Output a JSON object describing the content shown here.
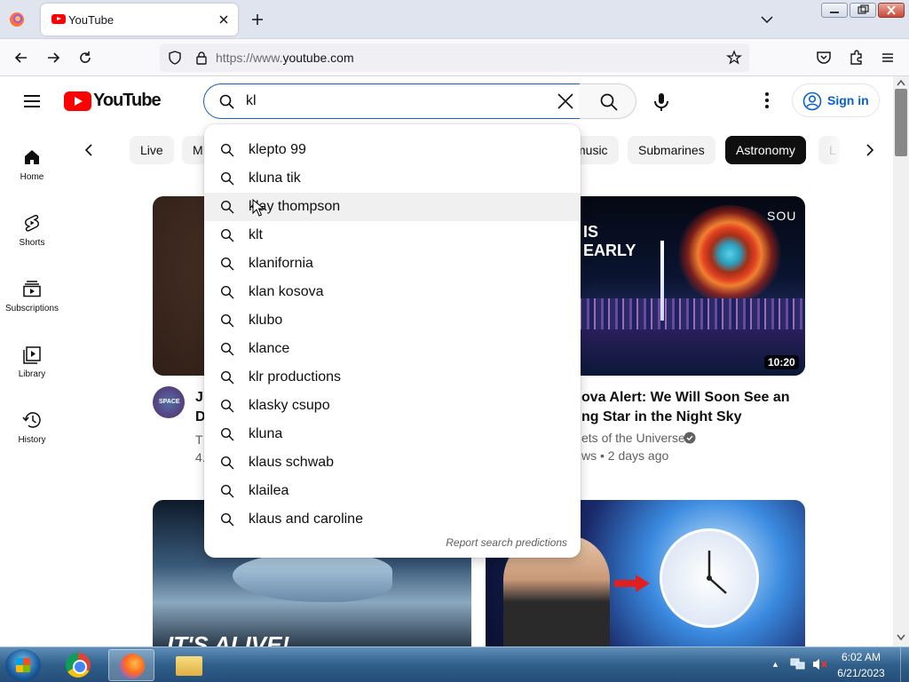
{
  "browser": {
    "tab_title": "YouTube",
    "url_prefix": "https://www.",
    "url_domain": "youtube.com"
  },
  "yt": {
    "logo_text": "YouTube",
    "search_value": "kl",
    "signin_label": "Sign in",
    "sidebar": [
      {
        "label": "Home",
        "icon": "home-icon"
      },
      {
        "label": "Shorts",
        "icon": "shorts-icon"
      },
      {
        "label": "Subscriptions",
        "icon": "subscriptions-icon"
      },
      {
        "label": "Library",
        "icon": "library-icon"
      },
      {
        "label": "History",
        "icon": "history-icon"
      }
    ],
    "chips": [
      "Live",
      "M",
      "music",
      "Submarines",
      "Astronomy",
      "L"
    ],
    "active_chip": "Astronomy",
    "suggestions": [
      "klepto 99",
      "kluna tik",
      "klay thompson",
      "klt",
      "klanifornia",
      "klan kosova",
      "klubo",
      "klance",
      "klr productions",
      "klasky csupo",
      "kluna",
      "klaus schwab",
      "klailea",
      "klaus and caroline"
    ],
    "report_link": "Report search predictions",
    "video_1": {
      "title_lines": [
        "J",
        "D"
      ],
      "meta_lines": [
        "T",
        "4."
      ],
      "avatar_text": "SPACE"
    },
    "video_2": {
      "thumb_text_lines": [
        "IS",
        "EARLY"
      ],
      "thumb_logo": "SOU",
      "duration": "10:20",
      "title": "ova Alert: We Will Soon See an ng Star in the Night Sky",
      "channel": "ets of the Universe",
      "meta": "ws • 2 days ago"
    },
    "video_3": {
      "thumb_text": "IT'S ALIVE!"
    }
  },
  "taskbar": {
    "time": "6:02 AM",
    "date": "6/21/2023"
  },
  "colors": {
    "yt_red": "#ff0000",
    "link_blue": "#065fd4",
    "search_focus": "#1c62b9",
    "chip_active": "#0f0f0f"
  }
}
